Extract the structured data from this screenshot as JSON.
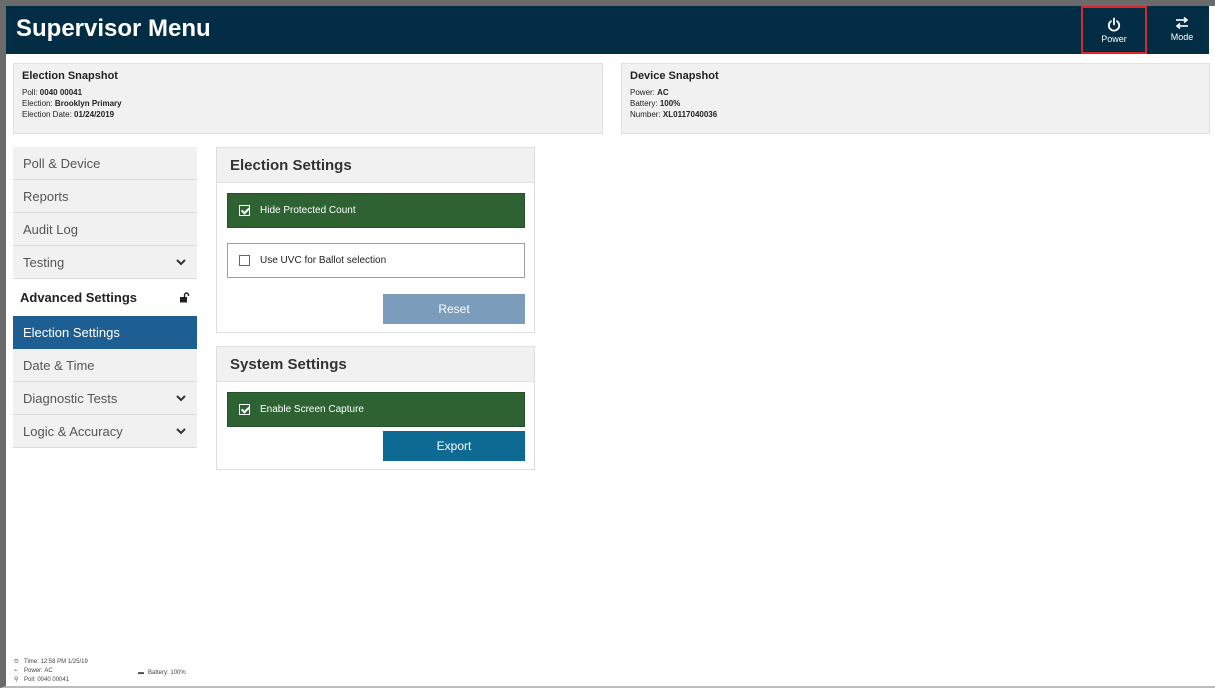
{
  "header": {
    "title": "Supervisor Menu",
    "power_label": "Power",
    "mode_label": "Mode",
    "background": "#032c45"
  },
  "election_snapshot": {
    "title": "Election Snapshot",
    "poll_label": "Poll:",
    "poll_value": "0040 00041",
    "election_label": "Election:",
    "election_value": "Brooklyn Primary",
    "date_label": "Election Date:",
    "date_value": "01/24/2019"
  },
  "device_snapshot": {
    "title": "Device Snapshot",
    "power_label": "Power:",
    "power_value": "AC",
    "battery_label": "Battery:",
    "battery_value": "100%",
    "number_label": "Number:",
    "number_value": "XL0117040036"
  },
  "sidebar": {
    "items_top": [
      {
        "label": "Poll & Device"
      },
      {
        "label": "Reports"
      },
      {
        "label": "Audit Log"
      },
      {
        "label": "Testing",
        "expandable": true
      }
    ],
    "section_label": "Advanced Settings",
    "items_bottom": [
      {
        "label": "Election Settings",
        "active": true
      },
      {
        "label": "Date & Time"
      },
      {
        "label": "Diagnostic Tests",
        "expandable": true
      },
      {
        "label": "Logic & Accuracy",
        "expandable": true
      }
    ],
    "active_color": "#1d5f93"
  },
  "election_settings": {
    "title": "Election Settings",
    "hide_protected_count": {
      "label": "Hide Protected Count",
      "checked": true
    },
    "use_uvc": {
      "label": "Use UVC for Ballot selection",
      "checked": false
    },
    "reset_label": "Reset"
  },
  "system_settings": {
    "title": "System Settings",
    "enable_screen_capture": {
      "label": "Enable Screen Capture",
      "checked": true
    },
    "export_label": "Export"
  },
  "footer": {
    "time_label": "Time:",
    "time_value": "12:58 PM 1/25/19",
    "power_label": "Power:",
    "power_value": "AC",
    "poll_label": "Poll:",
    "poll_value": "0040 00041",
    "battery_label": "Battery:",
    "battery_value": "100%"
  },
  "colors": {
    "checked_option": "#2e6233",
    "reset_button": "#7b9dbb",
    "export_button": "#0f6a93",
    "power_highlight": "#e0252a"
  },
  "icons": {
    "power": "power-icon",
    "mode": "swap-arrows-icon",
    "expand": "chevron-down-icon",
    "lock": "unlocked-padlock-icon",
    "checkbox": "checkbox-icon",
    "clock": "clock-icon",
    "plug": "plug-icon",
    "location": "location-pin-icon",
    "battery": "battery-icon"
  }
}
